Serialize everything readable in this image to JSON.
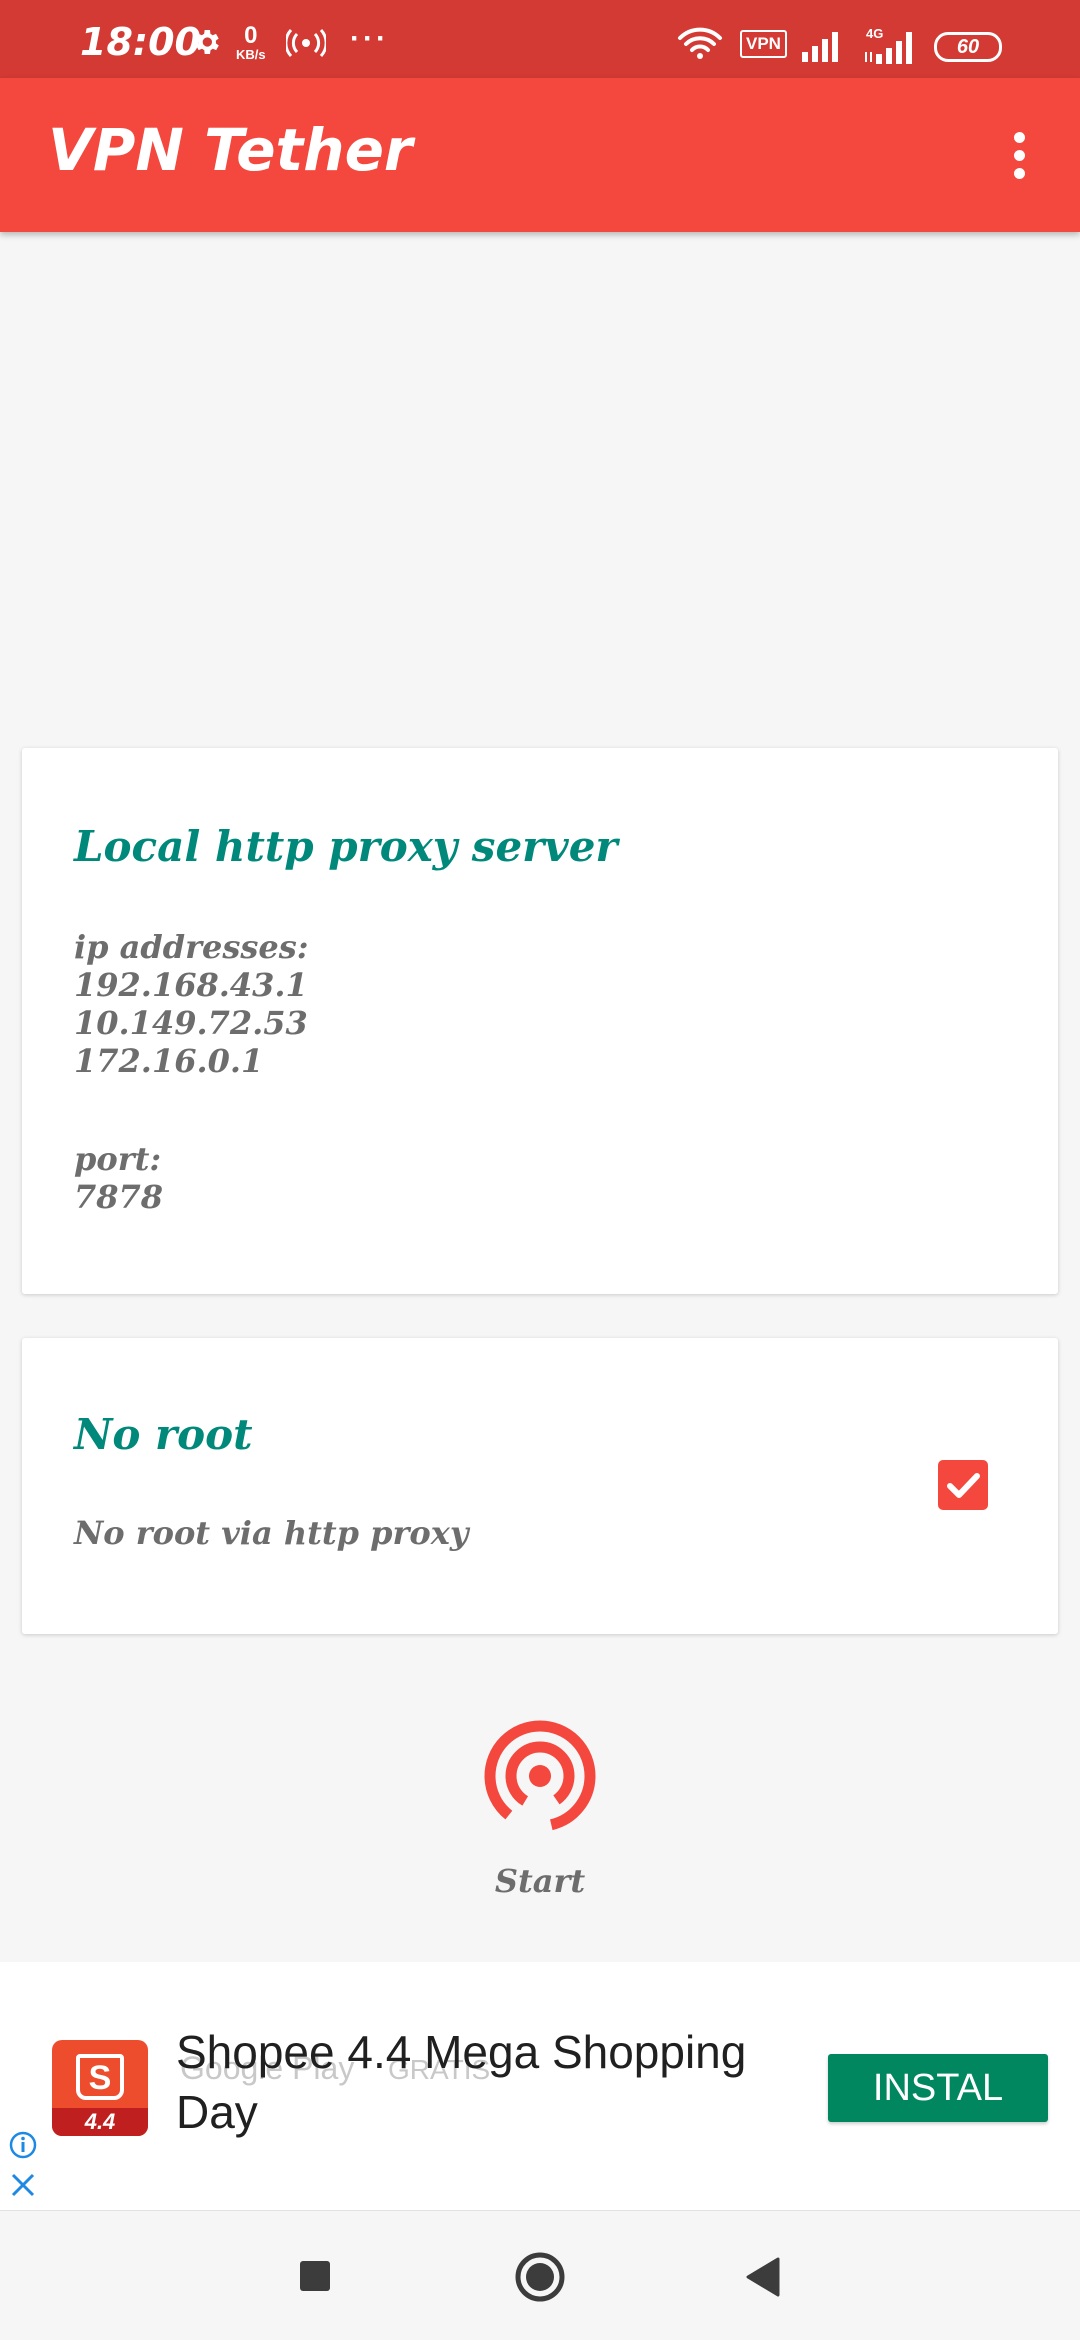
{
  "status_bar": {
    "time": "18:00",
    "net_speed_value": "0",
    "net_speed_unit": "KB/s",
    "more": "···",
    "vpn_badge": "VPN",
    "network_type": "4G",
    "battery_level": "60",
    "icons": [
      "gear-icon",
      "hotspot-icon",
      "wifi-icon",
      "signal-icon",
      "battery-icon"
    ]
  },
  "app_bar": {
    "title": "VPN Tether",
    "menu_icon": "overflow-menu-icon"
  },
  "proxy_card": {
    "title": "Local http proxy server",
    "ip_label": "ip addresses:",
    "ip_addresses": [
      "192.168.43.1",
      "10.149.72.53",
      "172.16.0.1"
    ],
    "port_label": "port:",
    "port": "7878"
  },
  "noroot_card": {
    "title": "No root",
    "summary": "No root via http proxy",
    "checked": true
  },
  "start": {
    "label": "Start",
    "icon": "broadcast-icon"
  },
  "ad": {
    "title": "Shopee 4.4 Mega Shopping Day",
    "store": "Google Play",
    "price": "GRATIS",
    "cta": "INSTAL",
    "logo_badge": "4.4",
    "logo_letter": "S"
  },
  "colors": {
    "status_bar": "#d33a34",
    "app_bar": "#f4473d",
    "accent_teal": "#00897b",
    "cta_green": "#01875f"
  }
}
